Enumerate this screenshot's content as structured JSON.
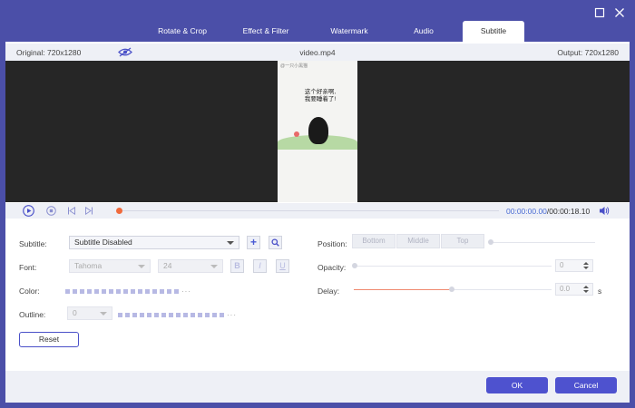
{
  "tabs": [
    "Rotate & Crop",
    "Effect & Filter",
    "Watermark",
    "Audio",
    "Subtitle"
  ],
  "active_tab": "Subtitle",
  "window_controls": {
    "maximize_icon": "maximize-icon",
    "close_icon": "close-icon"
  },
  "infobar": {
    "original": "Original: 720x1280",
    "filename": "video.mp4",
    "output": "Output: 720x1280",
    "eye_icon": "eye-icon"
  },
  "preview": {
    "watermark": "@一只小黑猫",
    "caption": "这个好亲啊,\n我要睡着了!",
    "cat_icon": "cat-illustration"
  },
  "playback": {
    "current_time": "00:00:00.00",
    "total_time": "/00:00:18.10",
    "play_icon": "play-icon",
    "stop_icon": "stop-icon",
    "prev_icon": "previous-icon",
    "next_icon": "next-icon",
    "volume_icon": "volume-icon",
    "progress": 0
  },
  "subtitle": {
    "label": "Subtitle:",
    "value": "Subtitle Disabled",
    "add_label": "+",
    "search_icon": "search-icon"
  },
  "font": {
    "label": "Font:",
    "family": "Tahoma",
    "size": "24",
    "bold": "B",
    "italic": "I",
    "underline": "U"
  },
  "color": {
    "label": "Color:",
    "more": "···"
  },
  "outline": {
    "label": "Outline:",
    "value": "0",
    "more": "···"
  },
  "position": {
    "label": "Position:",
    "options": [
      "Bottom",
      "Middle",
      "Top"
    ]
  },
  "opacity": {
    "label": "Opacity:",
    "value": "0"
  },
  "delay": {
    "label": "Delay:",
    "value": "0.0",
    "unit": "s"
  },
  "reset_label": "Reset",
  "ok_label": "OK",
  "cancel_label": "Cancel",
  "colors": {
    "accent": "#4e52cf",
    "frame": "#4b4fa8",
    "progress_dot": "#f06a3c",
    "time": "#4a6cd4"
  }
}
